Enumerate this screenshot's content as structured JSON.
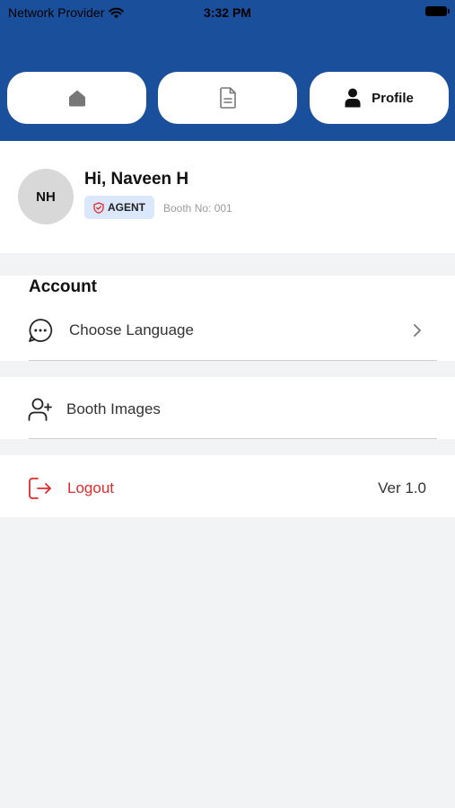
{
  "status_bar": {
    "carrier": "Network Provider",
    "time": "3:32 PM",
    "wifi_icon": "wifi-icon",
    "battery_icon": "battery-icon"
  },
  "tabs": [
    {
      "icon": "home-icon",
      "label": ""
    },
    {
      "icon": "document-icon",
      "label": ""
    },
    {
      "icon": "person-icon",
      "label": "Profile"
    }
  ],
  "profile": {
    "initials": "NH",
    "greeting": "Hi, Naveen H",
    "role_badge": "AGENT",
    "badge_icon": "shield-icon",
    "booth": "Booth No: 001"
  },
  "account": {
    "title": "Account",
    "items": [
      {
        "icon": "chat-bubble-icon",
        "label": "Choose Language",
        "chevron": "chevron-right-icon"
      }
    ]
  },
  "booth": {
    "items": [
      {
        "icon": "user-plus-icon",
        "label": "Booth Images"
      }
    ]
  },
  "logout": {
    "icon": "logout-icon",
    "label": "Logout",
    "version": "Ver 1.0"
  },
  "colors": {
    "header_bg": "#1a4f9c",
    "page_bg": "#f2f3f5",
    "badge_bg": "#dbe8fb",
    "logout_red": "#e22a2a"
  }
}
